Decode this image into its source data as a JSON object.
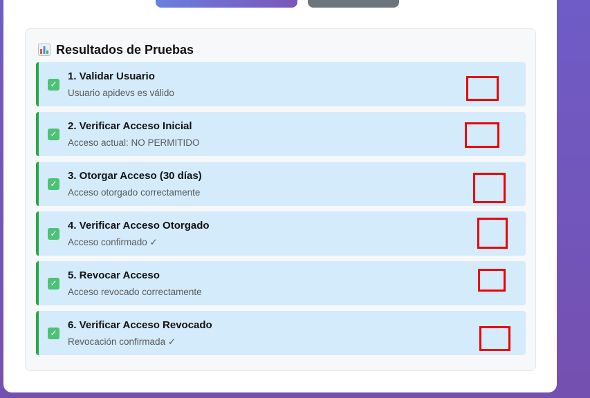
{
  "panel": {
    "title": "Resultados de Pruebas",
    "title_icon": "bar-chart-icon",
    "results": [
      {
        "title": "1. Validar Usuario",
        "detail": "Usuario apidevs es válido",
        "status_icon": "check-icon",
        "status": "success"
      },
      {
        "title": "2. Verificar Acceso Inicial",
        "detail": "Acceso actual: NO PERMITIDO",
        "status_icon": "check-icon",
        "status": "success"
      },
      {
        "title": "3. Otorgar Acceso (30 días)",
        "detail": "Acceso otorgado correctamente",
        "status_icon": "check-icon",
        "status": "success"
      },
      {
        "title": "4. Verificar Acceso Otorgado",
        "detail": "Acceso confirmado ✓",
        "status_icon": "check-icon",
        "status": "success"
      },
      {
        "title": "5. Revocar Acceso",
        "detail": "Acceso revocado correctamente",
        "status_icon": "check-icon",
        "status": "success"
      },
      {
        "title": "6. Verificar Acceso Revocado",
        "detail": "Revocación confirmada ✓",
        "status_icon": "check-icon",
        "status": "success"
      }
    ]
  },
  "colors": {
    "background": "#7450b0",
    "success_border": "#28a745",
    "item_background": "#d4ebfb",
    "annotation_box": "#ee0000"
  }
}
